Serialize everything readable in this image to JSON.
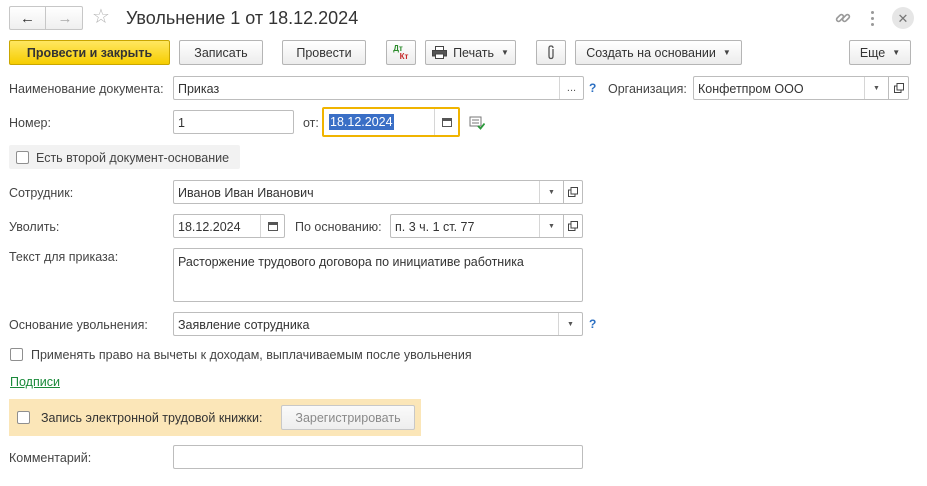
{
  "window": {
    "title": "Увольнение 1 от 18.12.2024"
  },
  "toolbar": {
    "post_and_close": "Провести и закрыть",
    "write": "Записать",
    "post": "Провести",
    "dt_kt_top": "Дт",
    "dt_kt_bottom": "Кт",
    "print": "Печать",
    "create_based_on": "Создать на основании",
    "more": "Еще"
  },
  "form": {
    "doc_name_label": "Наименование документа:",
    "doc_name_value": "Приказ",
    "doc_name_dots": "...",
    "help_mark": "?",
    "org_label": "Организация:",
    "org_value": "Конфетпром ООО",
    "number_label": "Номер:",
    "number_value": "1",
    "date_label": "от:",
    "date_value": "18.12.2024",
    "second_basis_label": "Есть второй документ-основание",
    "employee_label": "Сотрудник:",
    "employee_value": "Иванов Иван Иванович",
    "dismiss_label": "Уволить:",
    "dismiss_date": "18.12.2024",
    "grounds_label": "По основанию:",
    "grounds_value": "п. 3 ч. 1 ст. 77",
    "order_text_label": "Текст для приказа:",
    "order_text_value": "Расторжение трудового договора по инициативе работника",
    "reason_label": "Основание увольнения:",
    "reason_value": "Заявление сотрудника",
    "deductions_label": "Применять право на вычеты к доходам, выплачиваемым после увольнения",
    "signatures_link": "Подписи",
    "etk_label": "Запись электронной трудовой книжки:",
    "register_button": "Зарегистрировать",
    "comment_label": "Комментарий:",
    "comment_value": ""
  },
  "colors": {
    "primary_button": "#f6cd00",
    "focus_border": "#f0b400",
    "selection": "#3a6fc6",
    "link": "#1a8a3a",
    "etk_panel": "#fbe6b8"
  }
}
